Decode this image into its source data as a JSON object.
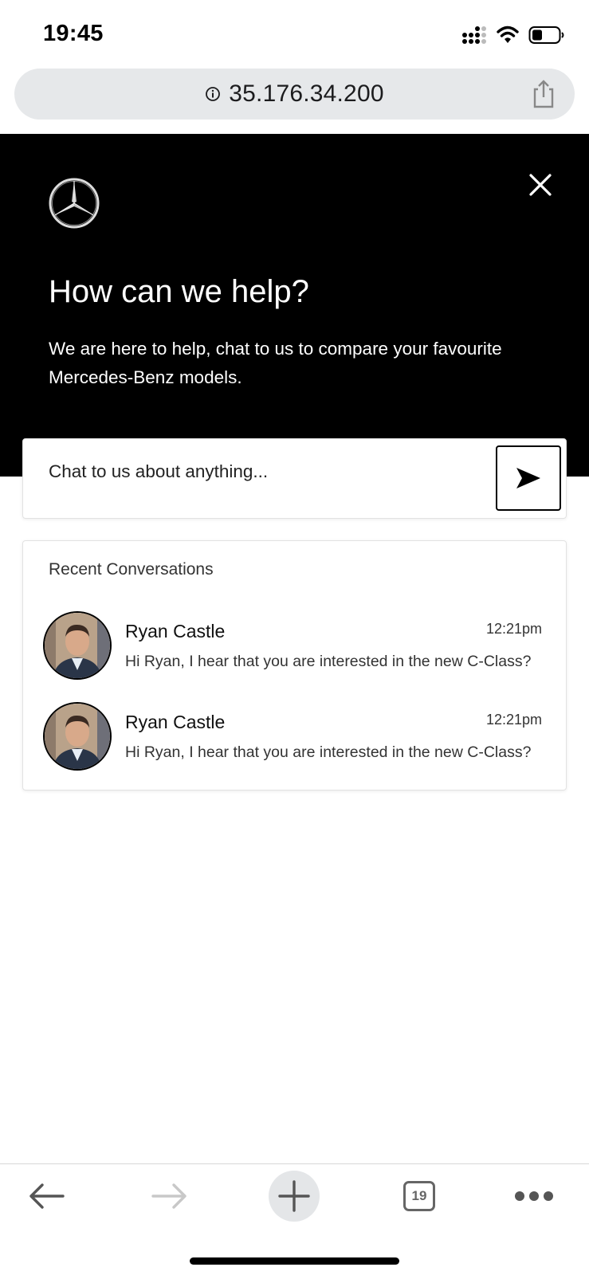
{
  "status_bar": {
    "time": "19:45",
    "icons": [
      "cellular-signal-icon",
      "wifi-icon",
      "battery-icon"
    ]
  },
  "browser": {
    "url": "35.176.34.200",
    "icons": [
      "info-icon",
      "share-icon"
    ]
  },
  "hero": {
    "logo": "mercedes-star-logo",
    "title": "How can we help?",
    "subtitle": "We are here to help, chat to us to compare your favourite Mercedes-Benz models.",
    "background": "#000000"
  },
  "chat": {
    "placeholder": "Chat to us about anything...",
    "send_icon": "send-icon"
  },
  "recent": {
    "heading": "Recent Conversations",
    "conversations": [
      {
        "name": "Ryan Castle",
        "time": "12:21pm",
        "message": "Hi Ryan, I hear that you are interested in the new C-Class?"
      },
      {
        "name": "Ryan Castle",
        "time": "12:21pm",
        "message": "Hi Ryan, I hear that you are interested in the new C-Class?"
      }
    ]
  },
  "toolbar": {
    "tab_count": "19",
    "icons": [
      "back-arrow-icon",
      "forward-arrow-icon",
      "plus-icon",
      "tabs-icon",
      "more-icon"
    ]
  }
}
